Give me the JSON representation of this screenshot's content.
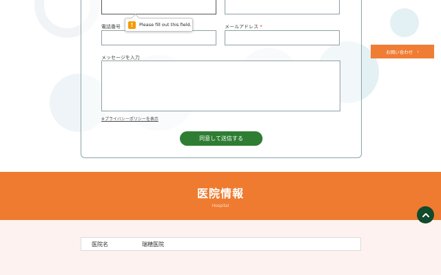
{
  "form": {
    "phone_label": "電話番号",
    "email_label": "メールアドレス",
    "required_mark": "*",
    "message_label": "メッセージを入力",
    "privacy_link": "※プライバシーポリシーを表示",
    "submit_label": "同意して送信する"
  },
  "validation": {
    "message": "Please fill out this field.",
    "icon": "warning-icon"
  },
  "side": {
    "contact_label": "お問い合わせ",
    "contact_arrow": "›"
  },
  "hospital": {
    "title": "医院情報",
    "subtitle": "Hospital",
    "rows": [
      {
        "key": "医院名",
        "value": "瑞穂医院"
      }
    ]
  },
  "colors": {
    "accent_orange": "#ee7b30",
    "submit_green": "#2e7d32",
    "scroll_top_green": "#124a2c"
  }
}
